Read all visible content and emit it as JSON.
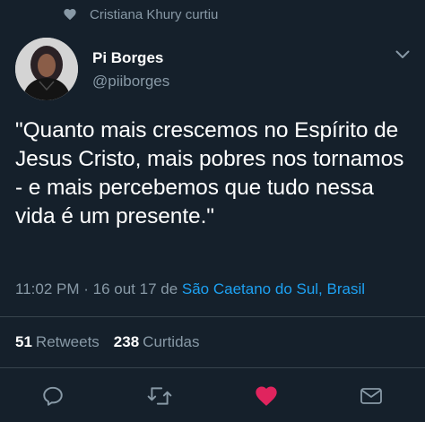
{
  "social_context": {
    "text": "Cristiana Khury curtiu",
    "icon": "heart-icon"
  },
  "author": {
    "display_name": "Pi Borges",
    "handle": "@piiborges"
  },
  "tweet": {
    "text": "\"Quanto mais crescemos no Espírito de Jesus Cristo, mais pobres nos tornamos - e mais percebemos que tudo nessa vida é um presente.\"",
    "time": "11:02 PM",
    "separator": " · ",
    "date": "16 out 17",
    "from_word": " de ",
    "location": "São Caetano do Sul, Brasil"
  },
  "stats": {
    "retweets_count": "51",
    "retweets_label": "Retweets",
    "likes_count": "238",
    "likes_label": "Curtidas"
  },
  "actions": [
    {
      "icon": "reply-icon"
    },
    {
      "icon": "retweet-icon"
    },
    {
      "icon": "like-icon",
      "active": true
    },
    {
      "icon": "direct-message-icon"
    }
  ],
  "colors": {
    "background": "#15202b",
    "text": "#ffffff",
    "secondary_text": "#8899a6",
    "link": "#1da1f2",
    "like": "#e0245e",
    "divider": "#38444d"
  }
}
